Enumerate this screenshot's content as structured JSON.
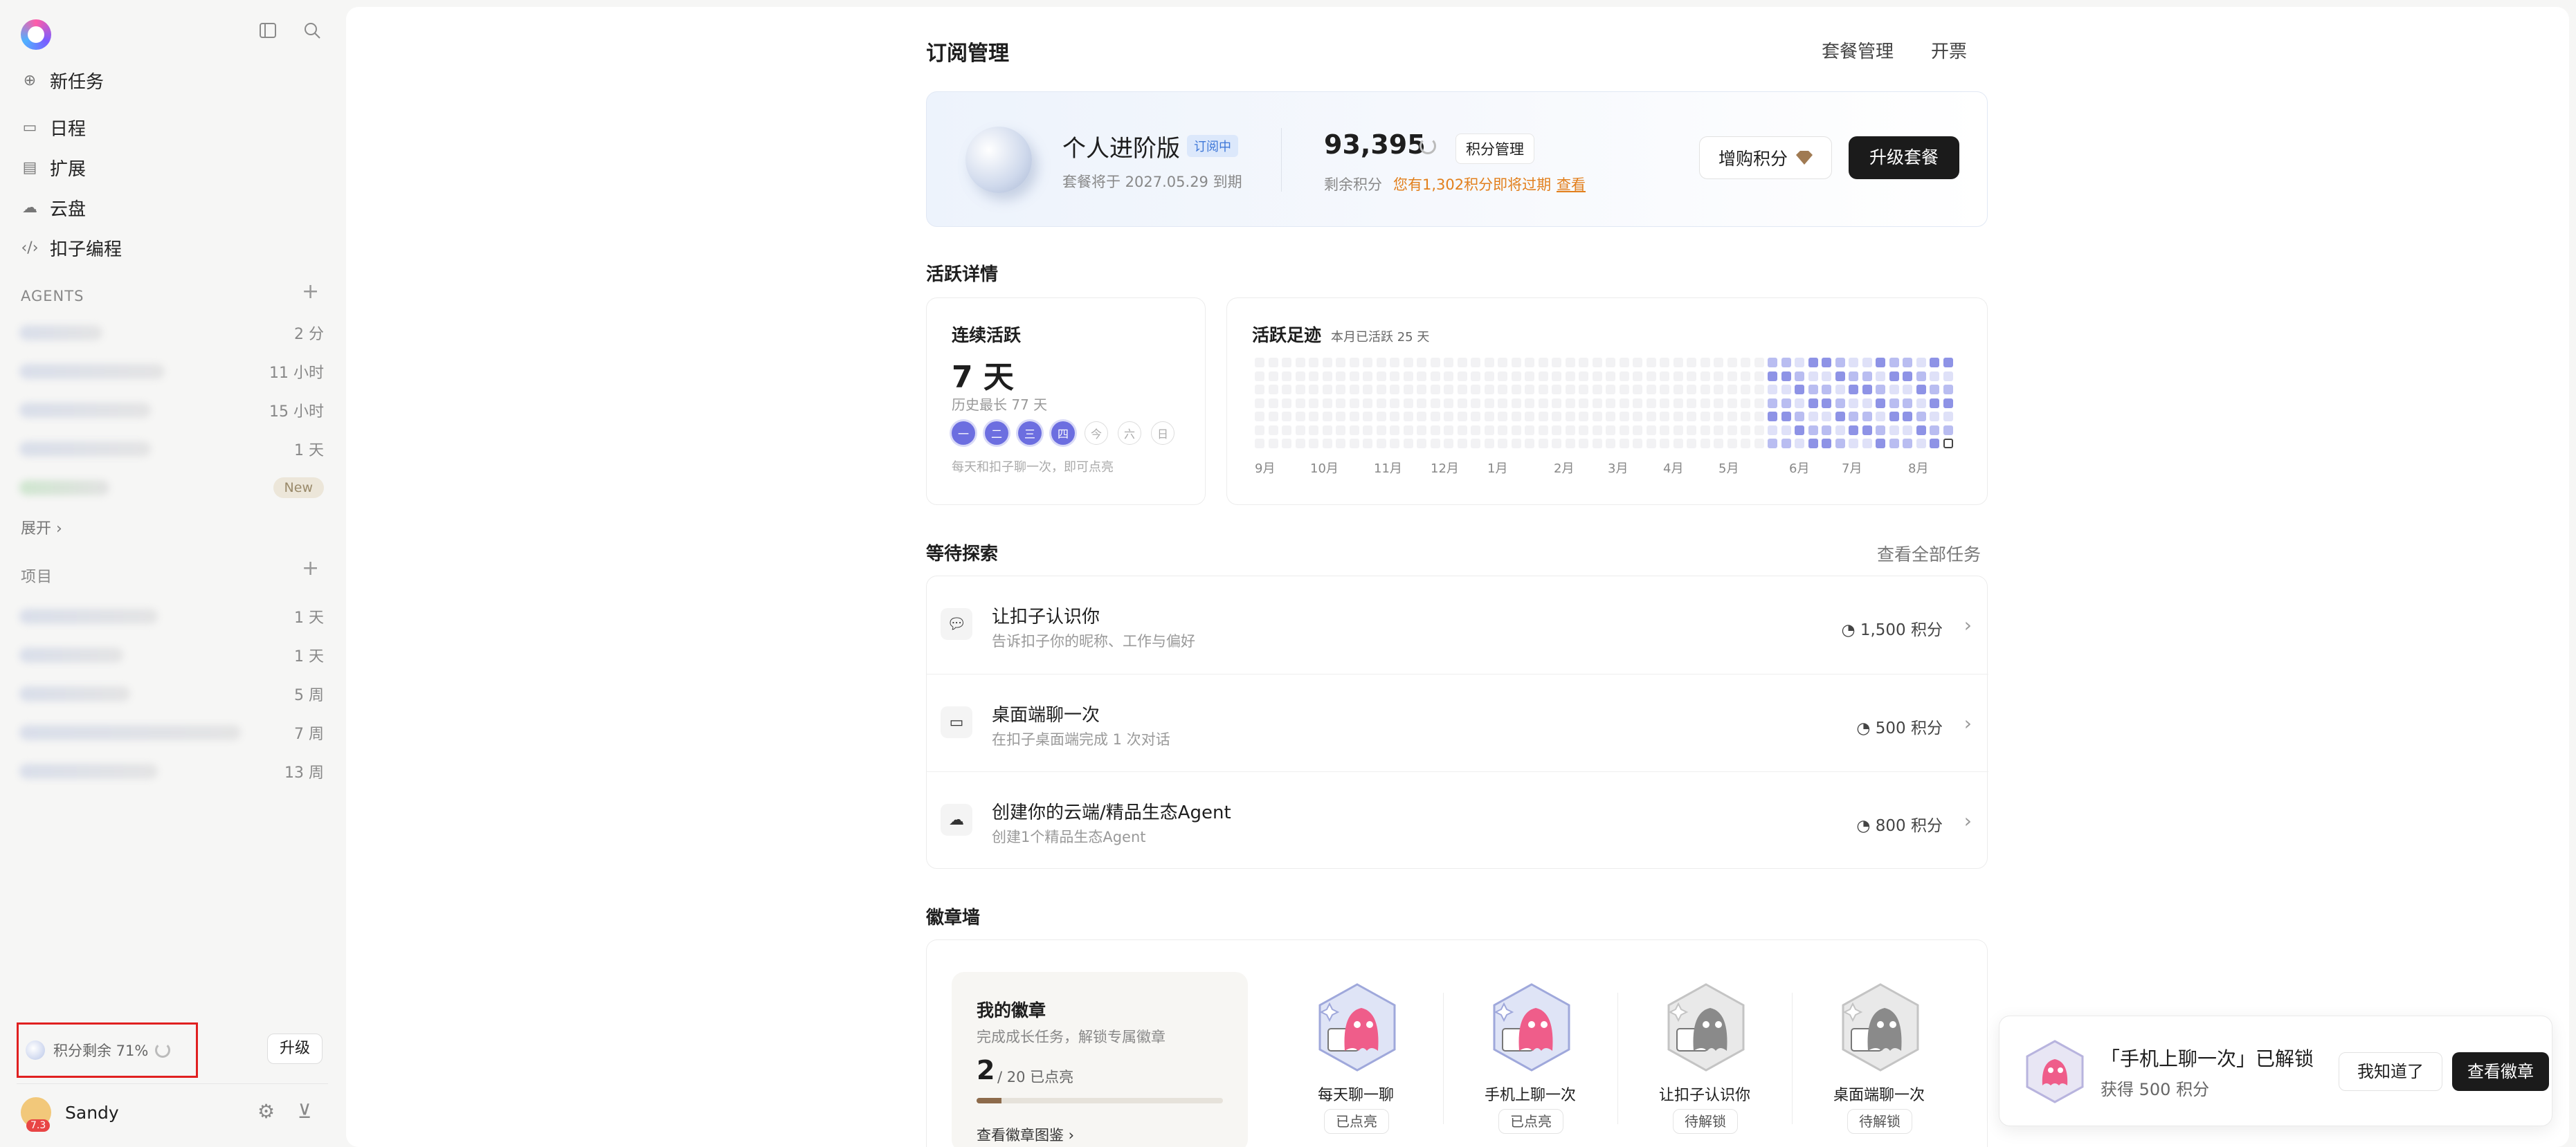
{
  "sidebar": {
    "nav": [
      {
        "label": "新任务",
        "icon": "plus-circle-icon"
      },
      {
        "label": "日程",
        "icon": "calendar-icon"
      },
      {
        "label": "扩展",
        "icon": "extension-icon"
      },
      {
        "label": "云盘",
        "icon": "cloud-icon"
      },
      {
        "label": "扣子编程",
        "icon": "code-icon"
      }
    ],
    "agents_label": "AGENTS",
    "agents": [
      {
        "meta": "2 分"
      },
      {
        "meta": "11 小时"
      },
      {
        "meta": "15 小时"
      },
      {
        "meta": "1 天"
      },
      {
        "meta": "New"
      }
    ],
    "expand_label": "展开 ›",
    "projects_label": "项目",
    "projects": [
      {
        "meta": "1 天"
      },
      {
        "meta": "1 天"
      },
      {
        "meta": "5 周"
      },
      {
        "meta": "7 周"
      },
      {
        "meta": "13 周"
      }
    ],
    "credits_remaining": "积分剩余 71%",
    "upgrade": "升级",
    "user_name": "Sandy",
    "user_badge": "7.3"
  },
  "header": {
    "title": "订阅管理",
    "links": [
      "套餐管理",
      "开票"
    ]
  },
  "plan": {
    "name": "个人进阶版",
    "status": "订阅中",
    "expiry": "套餐将于 2027.05.29 到期",
    "credits": "93,395",
    "credits_mgmt": "积分管理",
    "credits_label": "剩余积分",
    "expire_warning": "您有1,302积分即将过期",
    "view_link": "查看",
    "buy_label": "增购积分",
    "upgrade_label": "升级套餐"
  },
  "activity": {
    "section_title": "活跃详情",
    "streak_title": "连续活跃",
    "streak_days": "7 天",
    "streak_best": "历史最长 77 天",
    "weekdays": [
      {
        "label": "一",
        "active": true
      },
      {
        "label": "二",
        "active": true
      },
      {
        "label": "三",
        "active": true
      },
      {
        "label": "四",
        "active": true
      },
      {
        "label": "今",
        "active": false
      },
      {
        "label": "六",
        "active": false
      },
      {
        "label": "日",
        "active": false
      }
    ],
    "streak_hint": "每天和扣子聊一次，即可点亮",
    "heat_title": "活跃足迹",
    "heat_sub": "本月已活跃 25 天",
    "months": [
      "9月",
      "10月",
      "11月",
      "12月",
      "1月",
      "2月",
      "3月",
      "4月",
      "5月",
      "6月",
      "7月",
      "8月"
    ]
  },
  "explore": {
    "section_title": "等待探索",
    "view_all": "查看全部任务",
    "tasks": [
      {
        "name": "让扣子认识你",
        "desc": "告诉扣子你的昵称、工作与偏好",
        "points": "1,500 积分",
        "icon": "chat-icon"
      },
      {
        "name": "桌面端聊一次",
        "desc": "在扣子桌面端完成 1 次对话",
        "points": "500 积分",
        "icon": "laptop-icon"
      },
      {
        "name": "创建你的云端/精品生态Agent",
        "desc": "创建1个精品生态Agent",
        "points": "800 积分",
        "icon": "cloud-icon"
      }
    ]
  },
  "badges": {
    "section_title": "徽章墙",
    "my_title": "我的徽章",
    "my_sub": "完成成长任务，解锁专属徽章",
    "count": "2",
    "total": "/ 20  已点亮",
    "progress": 0.1,
    "link": "查看徽章图鉴 ›",
    "items": [
      {
        "name": "每天聊一聊",
        "status": "已点亮",
        "lit": true
      },
      {
        "name": "手机上聊一次",
        "status": "已点亮",
        "lit": true
      },
      {
        "name": "让扣子认识你",
        "status": "待解锁",
        "lit": false
      },
      {
        "name": "桌面端聊一次",
        "status": "待解锁",
        "lit": false
      }
    ]
  },
  "toast": {
    "title": "「手机上聊一次」已解锁",
    "sub": "获得 500 积分",
    "ok": "我知道了",
    "view": "查看徽章"
  },
  "colors": {
    "accent": "#6c6ee0",
    "heat_low": "#dfe1f8",
    "heat_mid": "#b9bdf1",
    "heat_high": "#8e93e6",
    "heat_empty": "#f2f2f4"
  }
}
